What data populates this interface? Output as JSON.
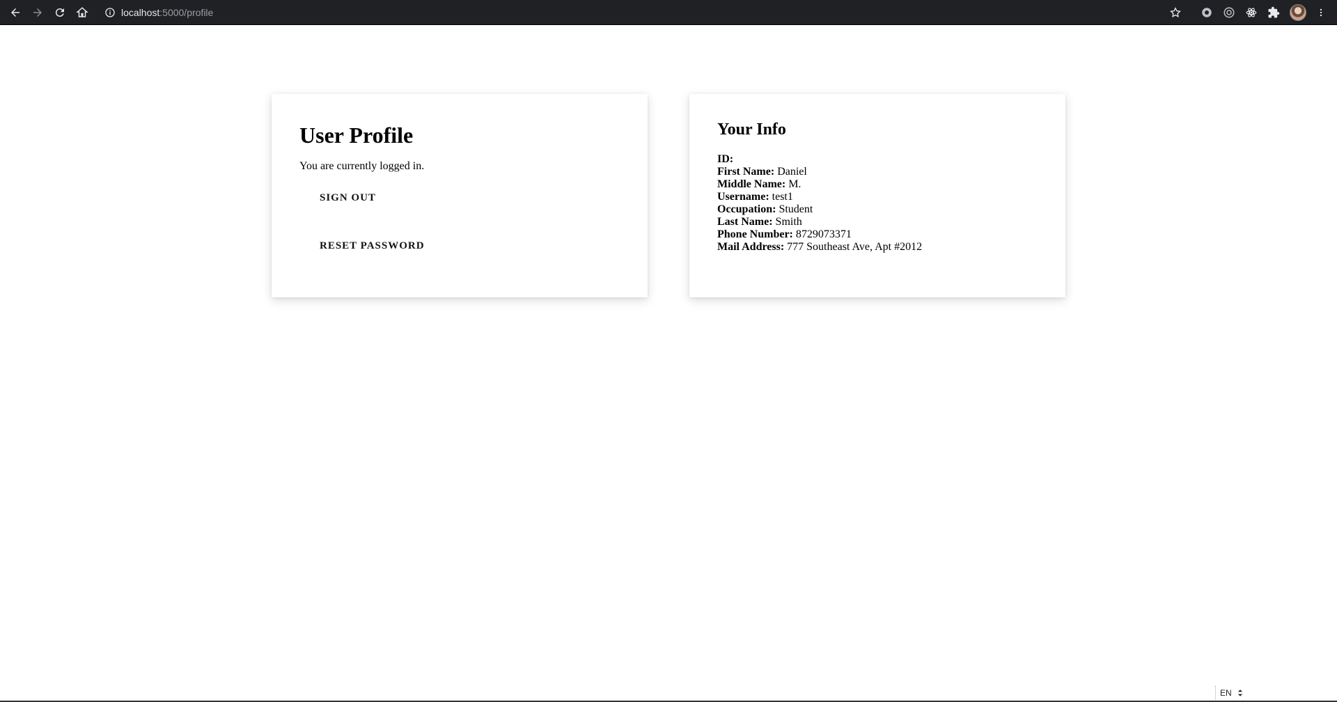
{
  "browser": {
    "url_host": "localhost",
    "url_path": ":5000/profile",
    "icons": [
      "back-icon",
      "forward-icon",
      "reload-icon",
      "home-icon",
      "info-icon",
      "star-icon",
      "extension-circle-icon",
      "extension-target-icon",
      "extension-atom-icon",
      "extensions-puzzle-icon",
      "profile-avatar",
      "menu-dots-icon"
    ]
  },
  "profile_card": {
    "title": "User Profile",
    "status_text": "You are currently logged in.",
    "sign_out_label": "SIGN OUT",
    "reset_password_label": "RESET PASSWORD"
  },
  "info_card": {
    "title": "Your Info",
    "fields": [
      {
        "label": "ID:",
        "value": ""
      },
      {
        "label": "First Name:",
        "value": "Daniel"
      },
      {
        "label": "Middle Name:",
        "value": "M."
      },
      {
        "label": "Username:",
        "value": "test1"
      },
      {
        "label": "Occupation:",
        "value": "Student"
      },
      {
        "label": "Last Name:",
        "value": "Smith"
      },
      {
        "label": "Phone Number:",
        "value": "8729073371"
      },
      {
        "label": "Mail Address:",
        "value": "777 Southeast Ave, Apt #2012"
      }
    ]
  },
  "footer": {
    "language": "EN"
  }
}
